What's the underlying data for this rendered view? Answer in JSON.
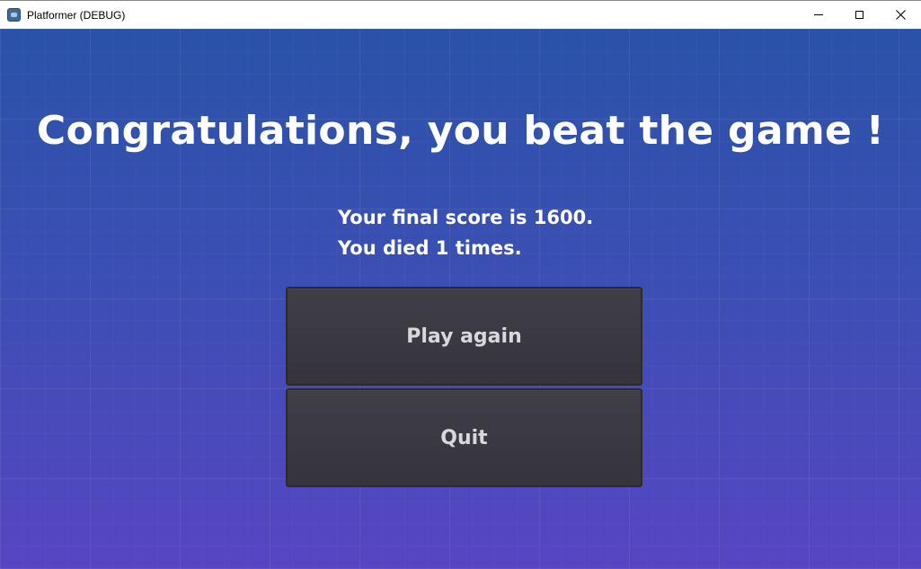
{
  "window": {
    "title": "Platformer (DEBUG)",
    "icon": "godot-app-icon",
    "controls": {
      "minimize": "minimize-icon",
      "maximize": "maximize-icon",
      "close": "close-icon",
      "close_glyph": "✕"
    }
  },
  "screen": {
    "headline": "Congratulations, you beat the game !",
    "score_line": "Your final score is 1600.",
    "deaths_line": "You died 1 times.",
    "score": 1600,
    "deaths": 1
  },
  "buttons": {
    "play_again": "Play again",
    "quit": "Quit"
  },
  "colors": {
    "background_top": "#2a52a8",
    "background_bottom": "#5745c2",
    "button_fill": "#3a3940",
    "button_text": "#d8d8dc",
    "text": "#ffffff"
  }
}
